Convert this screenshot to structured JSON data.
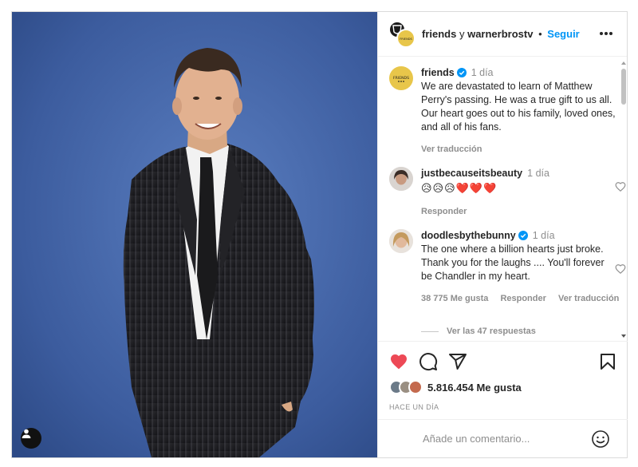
{
  "header": {
    "username": "friends",
    "connector": "y",
    "collab_username": "warnerbrostv",
    "separator": "•",
    "follow_label": "Seguir",
    "collab_logo_text": "FRIENDS"
  },
  "caption": {
    "username": "friends",
    "time": "1 día",
    "text": "We are devastated to learn of Matthew Perry's passing. He was a true gift to us all. Our heart goes out to his family, loved ones, and all of his fans.",
    "translate": "Ver traducción",
    "logo_text": "FRIENDS"
  },
  "comments": [
    {
      "username": "justbecauseitsbeauty",
      "time": "1 día",
      "text": "😥😥😥❤️❤️❤️",
      "reply": "Responder"
    },
    {
      "username": "doodlesbythebunny",
      "time": "1 día",
      "text": "The one where a billion hearts just broke. Thank you for the laughs .... You'll forever be Chandler in my heart.",
      "likes": "38 775 Me gusta",
      "reply": "Responder",
      "translate": "Ver traducción",
      "view_replies": "Ver las 47 respuestas"
    }
  ],
  "actions": {
    "likes": "5.816.454 Me gusta",
    "posted": "HACE UN DÍA",
    "liked": true,
    "like_color": "#ed4956"
  },
  "add_comment": {
    "placeholder": "Añade un comentario..."
  },
  "icons": {
    "header": [
      "warner-bros-logo-icon",
      "more-options-icon"
    ],
    "actions": [
      "heart-icon",
      "comment-icon",
      "share-icon",
      "bookmark-icon"
    ],
    "other": [
      "verified-badge-icon",
      "emoji-icon",
      "tagged-user-icon"
    ]
  },
  "colors": {
    "accent": "#0095f6",
    "photo_background": "#3f5f9c"
  }
}
